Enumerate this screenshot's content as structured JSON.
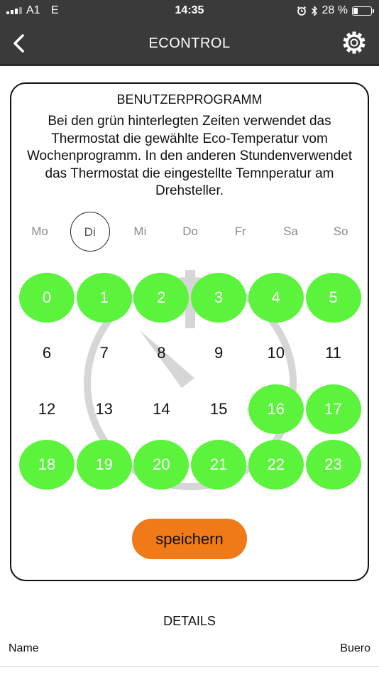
{
  "status": {
    "carrier": "A1",
    "network": "E",
    "time": "14:35",
    "battery_text": "28 %",
    "battery_level": 0.28
  },
  "header": {
    "title": "ECONTROL",
    "back_icon": "chevron-left-icon",
    "settings_icon": "gear-icon"
  },
  "card": {
    "heading": "BENUTZERPROGRAMM",
    "description": "Bei den grün hinterlegten Zeiten verwendet das Thermostat die gewählte Eco-Temperatur vom Wochenprogramm. In den anderen Stundenverwendet das Thermostat die eingestellte Temnperatur am Drehsteller.",
    "days": [
      {
        "label": "Mo",
        "selected": false
      },
      {
        "label": "Di",
        "selected": true
      },
      {
        "label": "Mi",
        "selected": false
      },
      {
        "label": "Do",
        "selected": false
      },
      {
        "label": "Fr",
        "selected": false
      },
      {
        "label": "Sa",
        "selected": false
      },
      {
        "label": "So",
        "selected": false
      }
    ],
    "hours": [
      {
        "label": "0",
        "eco": true
      },
      {
        "label": "1",
        "eco": true
      },
      {
        "label": "2",
        "eco": true
      },
      {
        "label": "3",
        "eco": true
      },
      {
        "label": "4",
        "eco": true
      },
      {
        "label": "5",
        "eco": true
      },
      {
        "label": "6",
        "eco": false
      },
      {
        "label": "7",
        "eco": false
      },
      {
        "label": "8",
        "eco": false
      },
      {
        "label": "9",
        "eco": false
      },
      {
        "label": "10",
        "eco": false
      },
      {
        "label": "11",
        "eco": false
      },
      {
        "label": "12",
        "eco": false
      },
      {
        "label": "13",
        "eco": false
      },
      {
        "label": "14",
        "eco": false
      },
      {
        "label": "15",
        "eco": false
      },
      {
        "label": "16",
        "eco": true
      },
      {
        "label": "17",
        "eco": true
      },
      {
        "label": "18",
        "eco": true
      },
      {
        "label": "19",
        "eco": true
      },
      {
        "label": "20",
        "eco": true
      },
      {
        "label": "21",
        "eco": true
      },
      {
        "label": "22",
        "eco": true
      },
      {
        "label": "23",
        "eco": true
      }
    ],
    "save_label": "speichern"
  },
  "details": {
    "heading": "DETAILS",
    "name_label": "Name",
    "name_value": "Buero"
  },
  "colors": {
    "eco_green": "#5cf33d",
    "save_orange": "#f07a18",
    "topbar": "#3a3a3a",
    "watermark_grey": "#d6d6d6"
  }
}
